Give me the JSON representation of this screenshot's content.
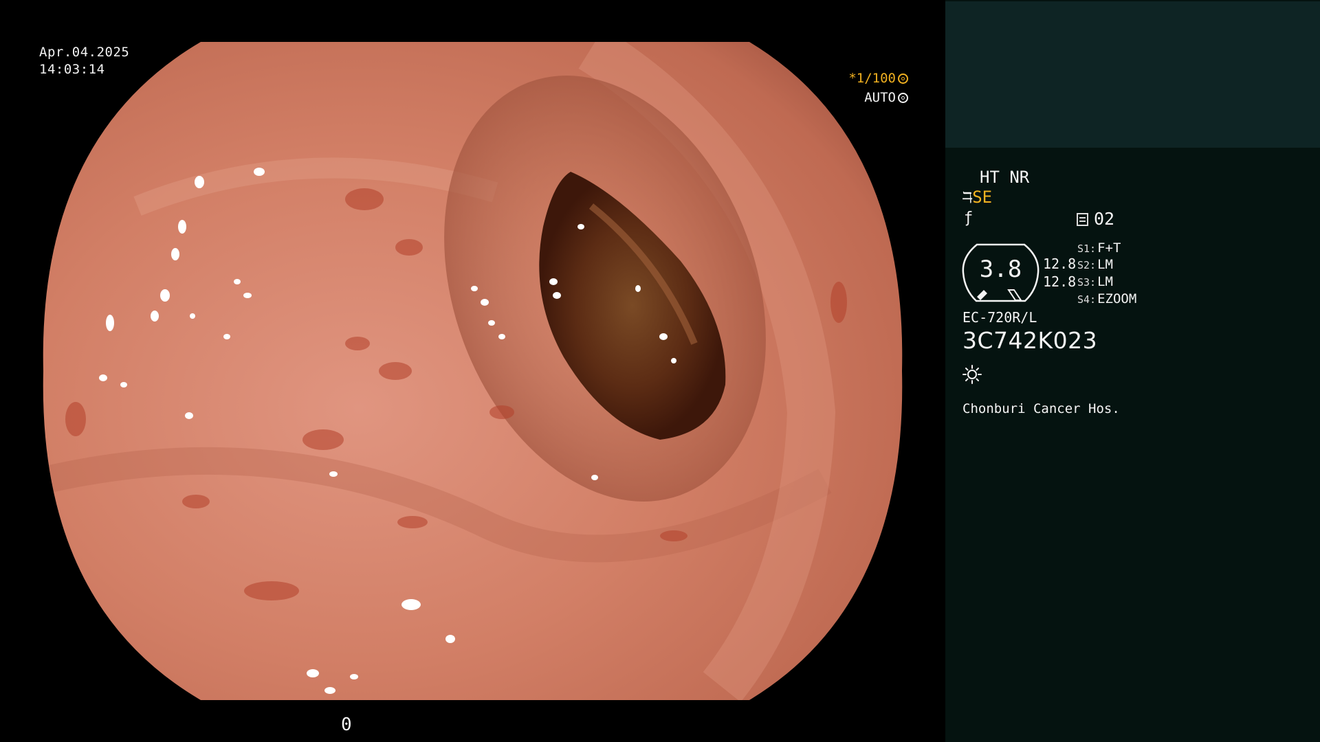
{
  "overlay": {
    "date": "Apr.04.2025",
    "time": "14:03:14",
    "shutter_speed": "*1/100",
    "iris_mode": "AUTO"
  },
  "panel": {
    "enhancement_mode": "HT NR",
    "structure_enhance": "SE",
    "memory_slot": "02",
    "gauge_value": "3.8",
    "value_a": "12.8",
    "value_b": "12.8",
    "switches": [
      {
        "key": "S1:",
        "value": "F+T"
      },
      {
        "key": "S2:",
        "value": "LM"
      },
      {
        "key": "S3:",
        "value": "LM"
      },
      {
        "key": "S4:",
        "value": "EZOOM"
      }
    ],
    "scope_model": "EC-720R/L",
    "serial_number": "3C742K023",
    "hospital": "Chonburi Cancer Hos.",
    "frame_counter": "0"
  },
  "colors": {
    "accent_orange": "#f3b321",
    "panel_bg": "#051310",
    "panel_top_bg": "#0e2424",
    "tissue": "#d8846a"
  },
  "icons": [
    "iris-icon",
    "sun-icon",
    "memory-icon",
    "scope-icon",
    "gauge-icon"
  ]
}
